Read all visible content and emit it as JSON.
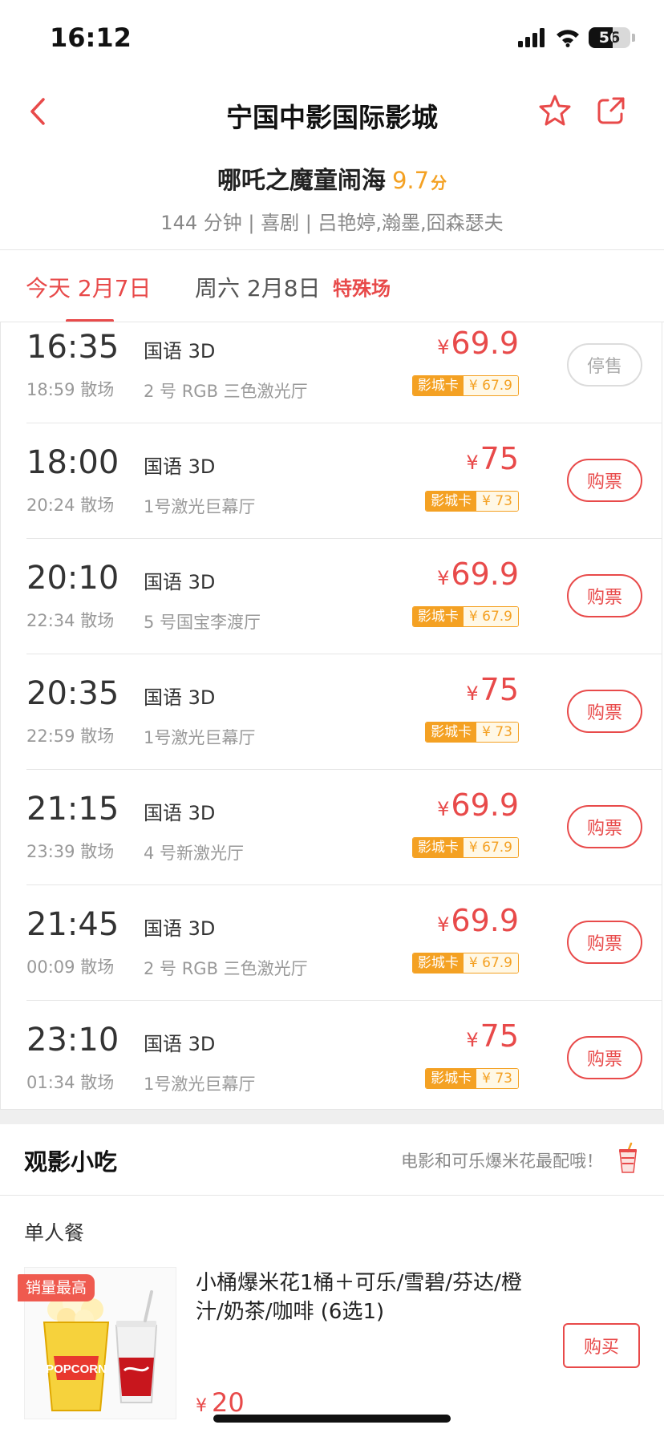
{
  "status_bar": {
    "time": "16:12",
    "battery": "56"
  },
  "header": {
    "title": "宁国中影国际影城"
  },
  "movie": {
    "title": "哪吒之魔童闹海",
    "score": "9.7",
    "score_unit": "分",
    "meta": "144 分钟 | 喜剧 | 吕艳婷,瀚墨,囧森瑟夫"
  },
  "date_tabs": [
    {
      "label": "今天 2月7日",
      "active": true
    },
    {
      "label": "周六 2月8日",
      "active": false
    }
  ],
  "special_label": "特殊场",
  "currency": "¥",
  "showtimes": [
    {
      "start": "16:35",
      "end": "18:59 散场",
      "lang": "国语 3D",
      "hall": "2 号 RGB 三色激光厅",
      "price": "69.9",
      "card_label": "影城卡",
      "card_price": "¥ 67.9",
      "button": "停售",
      "available": false
    },
    {
      "start": "18:00",
      "end": "20:24 散场",
      "lang": "国语 3D",
      "hall": "1号激光巨幕厅",
      "price": "75",
      "card_label": "影城卡",
      "card_price": "¥ 73",
      "button": "购票",
      "available": true
    },
    {
      "start": "20:10",
      "end": "22:34 散场",
      "lang": "国语 3D",
      "hall": "5 号国宝李渡厅",
      "price": "69.9",
      "card_label": "影城卡",
      "card_price": "¥ 67.9",
      "button": "购票",
      "available": true
    },
    {
      "start": "20:35",
      "end": "22:59 散场",
      "lang": "国语 3D",
      "hall": "1号激光巨幕厅",
      "price": "75",
      "card_label": "影城卡",
      "card_price": "¥ 73",
      "button": "购票",
      "available": true
    },
    {
      "start": "21:15",
      "end": "23:39 散场",
      "lang": "国语 3D",
      "hall": "4 号新激光厅",
      "price": "69.9",
      "card_label": "影城卡",
      "card_price": "¥ 67.9",
      "button": "购票",
      "available": true
    },
    {
      "start": "21:45",
      "end": "00:09 散场",
      "lang": "国语 3D",
      "hall": "2 号 RGB 三色激光厅",
      "price": "69.9",
      "card_label": "影城卡",
      "card_price": "¥ 67.9",
      "button": "购票",
      "available": true
    },
    {
      "start": "23:10",
      "end": "01:34 散场",
      "lang": "国语 3D",
      "hall": "1号激光巨幕厅",
      "price": "75",
      "card_label": "影城卡",
      "card_price": "¥ 73",
      "button": "购票",
      "available": true
    }
  ],
  "snacks": {
    "title": "观影小吃",
    "slogan": "电影和可乐爆米花最配哦！",
    "set_label": "单人餐",
    "item": {
      "badge": "销量最高",
      "name": "小桶爆米花1桶＋可乐/雪碧/芬达/橙汁/奶茶/咖啡 (6选1)",
      "price": "20",
      "button": "购买",
      "popcorn_text": "POPCORN"
    }
  },
  "colors": {
    "accent": "#e84a4a",
    "gold": "#f4a123"
  }
}
